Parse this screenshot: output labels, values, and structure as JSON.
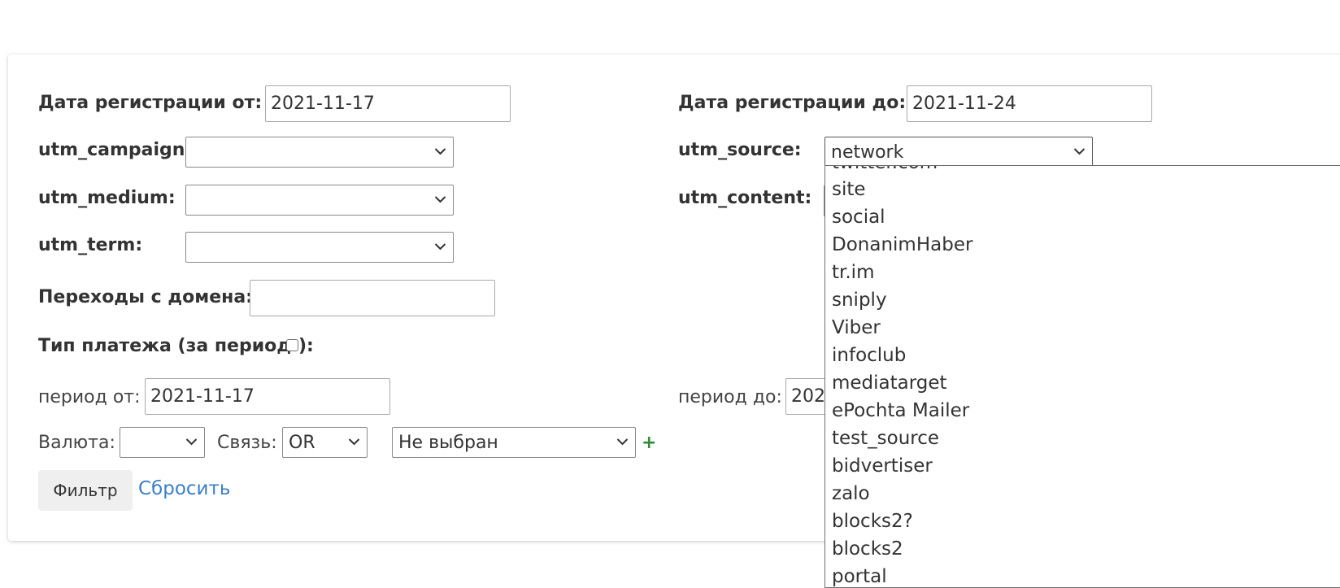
{
  "form": {
    "reg_from_label": "Дата регистрации от:",
    "reg_from_value": "2021-11-17",
    "reg_to_label": "Дата регистрации до:",
    "reg_to_value": "2021-11-24",
    "utm_campaign_label": "utm_campaign:",
    "utm_campaign_value": "",
    "utm_medium_label": "utm_medium:",
    "utm_medium_value": "",
    "utm_term_label": "utm_term:",
    "utm_term_value": "",
    "utm_source_label": "utm_source:",
    "utm_source_value": "network",
    "utm_content_label": "utm_content:",
    "domain_label": "Переходы с домена:",
    "domain_value": "",
    "payment_type_label_pre": "Тип платежа (за период",
    "payment_type_label_post": "):",
    "period_from_label": "период от:",
    "period_from_value": "2021-11-17",
    "period_to_label": "период до:",
    "period_to_value": "202",
    "currency_label": "Валюта:",
    "currency_value": "",
    "link_label": "Связь:",
    "link_value": "OR",
    "payment_select_value": "Не выбран",
    "plus_label": "+",
    "filter_button": "Фильтр",
    "reset_link": "Сбросить"
  },
  "utm_source_dropdown": {
    "partial_top": "twitter.com",
    "options": [
      "site",
      "social",
      "DonanimHaber",
      "tr.im",
      "sniply",
      "Viber",
      "infoclub",
      "mediatarget",
      "ePochta Mailer",
      "test_source",
      "bidvertiser",
      "zalo",
      "blocks2?",
      "blocks2"
    ],
    "partial_bottom": "portal"
  },
  "colors": {
    "link": "#3a7fc8",
    "plus": "#2e8b3a",
    "button_bg": "#efefef"
  }
}
